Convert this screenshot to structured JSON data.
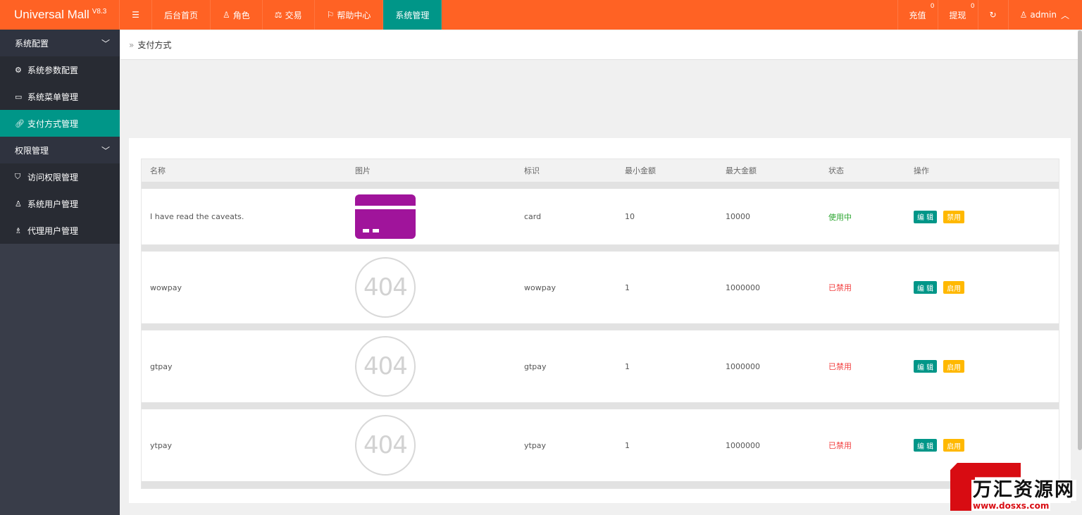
{
  "app": {
    "name": "Universal Mall",
    "version": "V8.3"
  },
  "topnav": {
    "items": [
      {
        "label": "后台首页",
        "icon": ""
      },
      {
        "label": "角色",
        "icon": "user-icon"
      },
      {
        "label": "交易",
        "icon": "scale-icon"
      },
      {
        "label": "帮助中心",
        "icon": "flag-icon"
      },
      {
        "label": "系统管理",
        "icon": ""
      }
    ],
    "recharge": {
      "label": "充值",
      "count": "0"
    },
    "withdraw": {
      "label": "提现",
      "count": "0"
    },
    "user": "admin"
  },
  "sidebar": {
    "groups": [
      {
        "label": "系统配置",
        "items": [
          "系统参数配置",
          "系统菜单管理",
          "支付方式管理"
        ]
      },
      {
        "label": "权限管理",
        "items": [
          "访问权限管理",
          "系统用户管理",
          "代理用户管理"
        ]
      }
    ]
  },
  "breadcrumb": "支付方式",
  "table": {
    "headers": [
      "名称",
      "图片",
      "标识",
      "最小金额",
      "最大金额",
      "状态",
      "操作"
    ],
    "rows": [
      {
        "name": "I have read the caveats.",
        "image": "card",
        "id": "card",
        "min": "10",
        "max": "10000",
        "status": "使用中",
        "edit": "编 辑",
        "toggle": "禁用"
      },
      {
        "name": "wowpay",
        "image": "404",
        "id": "wowpay",
        "min": "1",
        "max": "1000000",
        "status": "已禁用",
        "edit": "编 辑",
        "toggle": "启用"
      },
      {
        "name": "gtpay",
        "image": "404",
        "id": "gtpay",
        "min": "1",
        "max": "1000000",
        "status": "已禁用",
        "edit": "编 辑",
        "toggle": "启用"
      },
      {
        "name": "ytpay",
        "image": "404",
        "id": "ytpay",
        "min": "1",
        "max": "1000000",
        "status": "已禁用",
        "edit": "编 辑",
        "toggle": "启用"
      }
    ]
  },
  "watermark": {
    "text": "万汇资源网",
    "url": "www.dosxs.com"
  },
  "colors": {
    "topbar": "#ff6224",
    "accent": "#009688",
    "warn": "#ffb800",
    "sidebar": "#393d49",
    "on": "#2aa52f",
    "off": "#f23f3f"
  }
}
